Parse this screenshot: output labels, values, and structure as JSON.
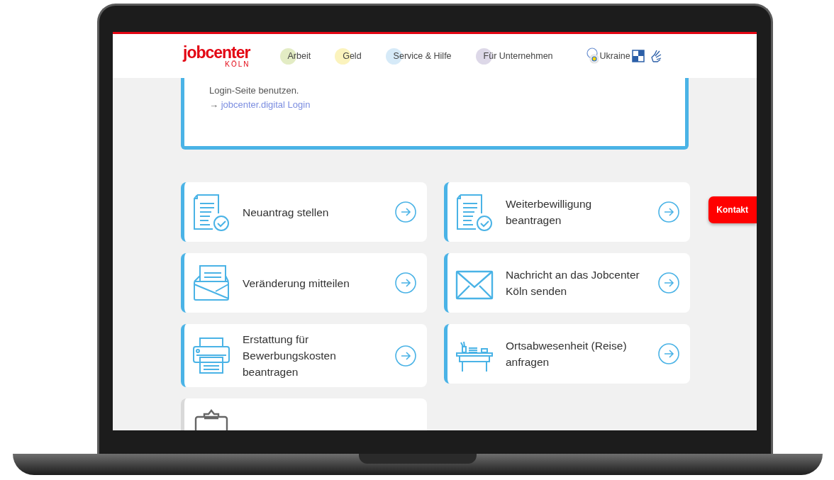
{
  "header": {
    "logo": {
      "name": "jobcenter",
      "city": "KÖLN"
    },
    "nav": [
      {
        "label": "Arbeit",
        "color": "#e3ecc4"
      },
      {
        "label": "Geld",
        "color": "#fbf3bd"
      },
      {
        "label": "Service & Hilfe",
        "color": "#d6eaf8"
      },
      {
        "label": "Für Unternehmen",
        "color": "#ddd8e8"
      }
    ],
    "language": {
      "label": "Ukraine"
    }
  },
  "info_box": {
    "lines": [
      "Login-Seite benutzen."
    ],
    "arrow": "→",
    "link": "jobcenter.digital Login"
  },
  "left_cards": [
    {
      "title": "Neuantrag stellen",
      "kind": "document"
    },
    {
      "title": "Veränderung mitteilen",
      "kind": "letter"
    },
    {
      "title": "Erstattung für Bewerbungskosten beantragen",
      "kind": "printer"
    },
    {
      "kind": "clipboard"
    }
  ],
  "right_cards": [
    {
      "title": "Weiterbewilligung beantragen",
      "kind": "document"
    },
    {
      "title": "Nachricht an das Jobcenter Köln senden",
      "kind": "envelope"
    },
    {
      "title": "Ortsabwesenheit (Reise) anfragen",
      "kind": "desk"
    }
  ],
  "contact_button": "Kontakt"
}
